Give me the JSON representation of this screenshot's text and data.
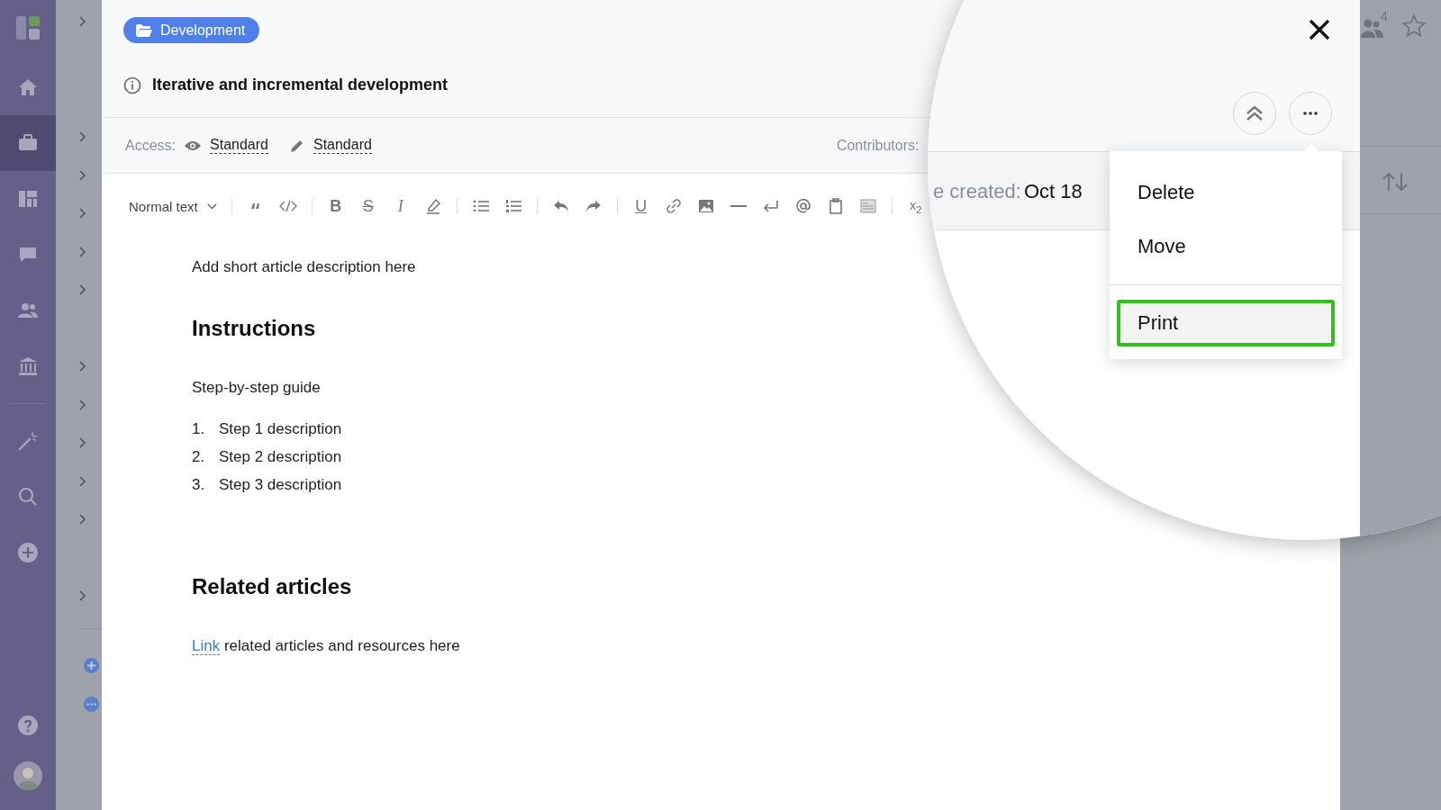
{
  "sidebar": {
    "items": [
      {
        "selected": false
      },
      {
        "selected": true
      },
      {
        "selected": false
      },
      {
        "selected": false
      },
      {
        "selected": false
      },
      {
        "selected": false
      },
      {
        "selected": false
      },
      {
        "selected": false
      },
      {
        "selected": false
      }
    ]
  },
  "right_panel": {
    "members_badge": "4"
  },
  "article": {
    "folder": "Development",
    "title": "Iterative and incremental development",
    "access": {
      "label": "Access:",
      "view": "Standard",
      "edit": "Standard"
    },
    "contributors_label": "Contributors:",
    "toolbar": {
      "style_select": "Normal text",
      "bold": "B",
      "strike": "S",
      "italic": "I",
      "underline": "U",
      "subscript": "x$_{2}$"
    },
    "content": [
      {
        "kind": "paragraph",
        "text": "Add short article description here"
      },
      {
        "kind": "heading",
        "text": "Instructions"
      },
      {
        "kind": "paragraph",
        "text": "Step-by-step guide"
      },
      {
        "kind": "list",
        "items": [
          {
            "marker": "1.",
            "text": "Step 1 description"
          },
          {
            "marker": "2.",
            "text": "Step 2 description"
          },
          {
            "marker": "3.",
            "text": "Step 3 description"
          }
        ]
      },
      {
        "kind": "heading",
        "text": "Related articles"
      },
      {
        "kind": "paragraph",
        "link": "Link",
        "text": "related articles and resources here"
      }
    ]
  },
  "magnifier": {
    "created_label": "e created:",
    "created_value": "Oct 18",
    "menu": {
      "sections": [
        [
          {
            "label": "Delete",
            "selected": false
          },
          {
            "label": "Move",
            "selected": false
          }
        ],
        [
          {
            "label": "Print",
            "selected": true
          }
        ]
      ]
    }
  }
}
